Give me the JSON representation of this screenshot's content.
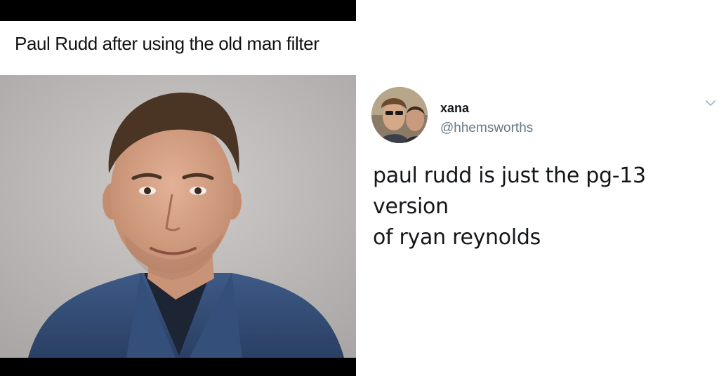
{
  "meme": {
    "caption": "Paul Rudd after using the old man filter"
  },
  "tweet": {
    "display_name": "xana",
    "handle": "@hhemsworths",
    "text_line1": "paul rudd is just the pg-13 version",
    "text_line2": "of ryan reynolds",
    "menu_icon": "chevron-down-icon"
  }
}
